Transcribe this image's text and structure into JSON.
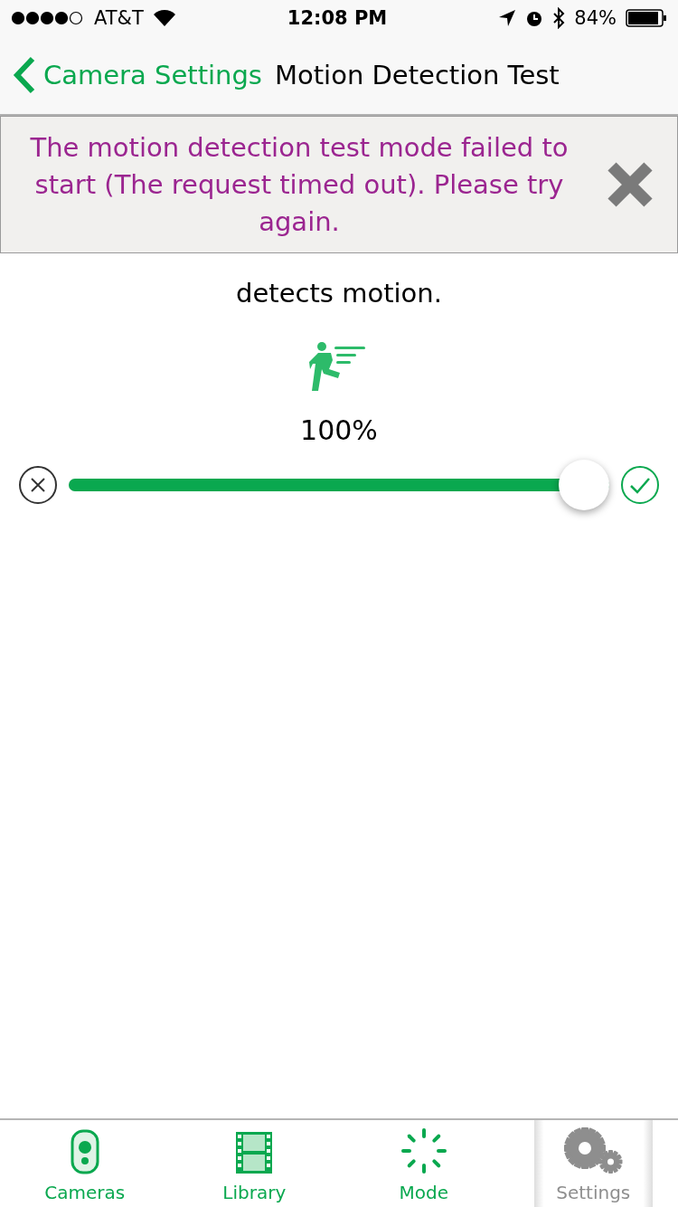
{
  "status_bar": {
    "carrier": "AT&T",
    "time": "12:08 PM",
    "battery": "84%"
  },
  "nav": {
    "back": "Camera Settings",
    "title": "Motion Detection Test"
  },
  "error_banner": {
    "message": "The motion detection test mode failed to start (The request timed out). Please try again."
  },
  "description": "detects motion.",
  "sensitivity": {
    "reading": "100%",
    "level": 1.0
  },
  "tabs": [
    {
      "label": "Cameras",
      "kind": "camera",
      "selected": false
    },
    {
      "label": "Library",
      "kind": "film",
      "selected": false
    },
    {
      "label": "Mode",
      "kind": "mode",
      "selected": false
    },
    {
      "label": "Settings",
      "kind": "gear",
      "selected": true
    }
  ]
}
